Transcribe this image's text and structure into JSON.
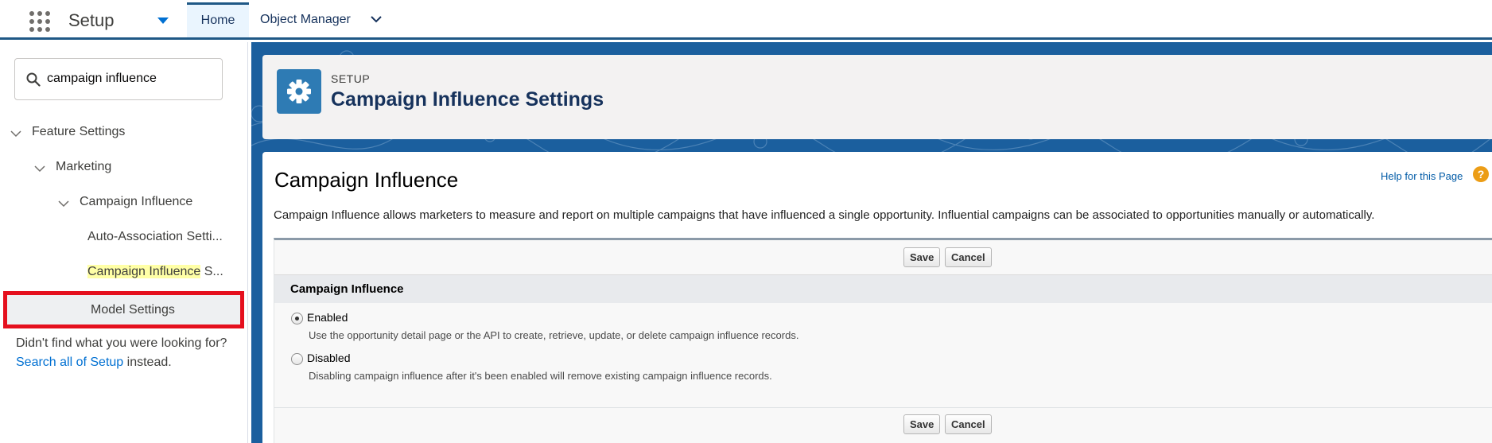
{
  "topbar": {
    "app_name": "Setup",
    "tabs": [
      {
        "label": "Home"
      },
      {
        "label": "Object Manager"
      }
    ]
  },
  "sidebar": {
    "search": {
      "value": "campaign influence"
    },
    "tree": [
      {
        "label": "Feature Settings"
      },
      {
        "label": "Marketing"
      },
      {
        "label": "Campaign Influence"
      },
      {
        "label": "Auto-Association Setti..."
      },
      {
        "label_highlight": "Campaign Influence",
        "label_rest": " S..."
      },
      {
        "label": "Model Settings"
      }
    ],
    "not_found": {
      "text_before": "Didn't find what you were looking for? ",
      "link": "Search all of Setup",
      "text_after": " instead."
    }
  },
  "header": {
    "eyebrow": "SETUP",
    "title": "Campaign Influence Settings",
    "icon": "gear-icon"
  },
  "content": {
    "heading": "Campaign Influence",
    "help_link": "Help for this Page",
    "help_icon": "?",
    "description": "Campaign Influence allows marketers to measure and report on multiple campaigns that have influenced a single opportunity. Influential campaigns can be associated to opportunities manually or automatically.",
    "buttons": {
      "save": "Save",
      "cancel": "Cancel"
    },
    "section_title": "Campaign Influence",
    "options": [
      {
        "label": "Enabled",
        "help": "Use the opportunity detail page or the API to create, retrieve, update, or delete campaign influence records.",
        "checked": true
      },
      {
        "label": "Disabled",
        "help": "Disabling campaign influence after it's been enabled will remove existing campaign influence records.",
        "checked": false
      }
    ]
  },
  "colors": {
    "brand_blue": "#1b5f9e",
    "link": "#0070d2",
    "highlight_box": "#e5101e",
    "search_highlight": "#ffffa6"
  }
}
